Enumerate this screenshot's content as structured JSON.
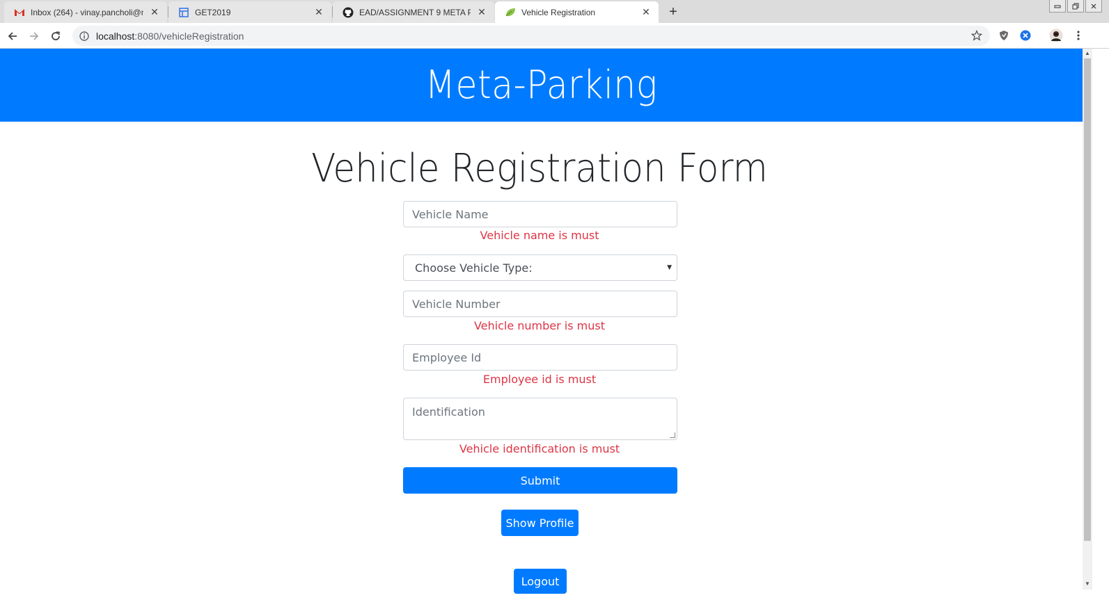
{
  "browser": {
    "tabs": [
      {
        "title": "Inbox (264) - vinay.pancholi@me",
        "icon": "gmail-icon"
      },
      {
        "title": "GET2019",
        "icon": "sheet-icon"
      },
      {
        "title": "EAD/ASSIGNMENT 9 META PARK",
        "icon": "github-icon"
      },
      {
        "title": "Vehicle Registration",
        "icon": "leaf-icon"
      }
    ],
    "close_glyph": "✕",
    "new_tab_glyph": "+",
    "url_host": "localhost",
    "url_path": ":8080/vehicleRegistration"
  },
  "app": {
    "brand": "Meta-Parking",
    "form_title": "Vehicle Registration Form",
    "fields": {
      "vehicle_name_placeholder": "Vehicle Name",
      "vehicle_name_error": "Vehicle name is must",
      "vehicle_type_selected": "Choose Vehicle Type:",
      "vehicle_number_placeholder": "Vehicle Number",
      "vehicle_number_error": "Vehicle number is must",
      "employee_id_placeholder": "Employee Id",
      "employee_id_error": "Employee id is must",
      "identification_placeholder": "Identification",
      "identification_error": "Vehicle identification is must"
    },
    "buttons": {
      "submit": "Submit",
      "show_profile": "Show Profile",
      "logout": "Logout"
    },
    "colors": {
      "primary": "#007bff",
      "error": "#dc3545"
    }
  }
}
